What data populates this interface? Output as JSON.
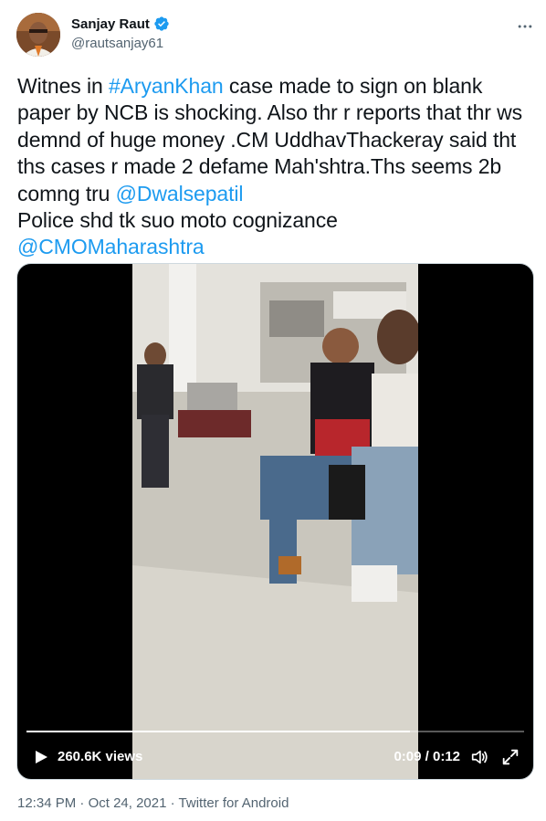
{
  "author": {
    "display_name": "Sanjay Raut",
    "handle": "@rautsanjay61",
    "verified": true
  },
  "tweet": {
    "lines": [
      [
        {
          "text": "Witnes in ",
          "link": false
        },
        {
          "text": "#AryanKhan",
          "link": true
        },
        {
          "text": " case made to sign on blank",
          "link": false
        }
      ],
      [
        {
          "text": "paper by NCB is shocking. Also thr r reports that thr ws",
          "link": false
        }
      ],
      [
        {
          "text": "demnd of huge money .CM UddhavThackeray said tht",
          "link": false
        }
      ],
      [
        {
          "text": "ths cases r made 2 defame Mah'shtra.Ths seems 2b",
          "link": false
        }
      ],
      [
        {
          "text": "comng tru ",
          "link": false
        },
        {
          "text": "@Dwalsepatil",
          "link": true
        }
      ],
      [
        {
          "text": "Police shd tk suo moto cognizance",
          "link": false
        }
      ],
      [
        {
          "text": "@CMOMaharashtra",
          "link": true
        }
      ]
    ]
  },
  "video": {
    "views": "260.6K views",
    "time": "0:09 / 0:12",
    "progress_fraction": 0.77
  },
  "footer": {
    "time": "12:34 PM",
    "separator": "·",
    "date": "Oct 24, 2021",
    "source": "Twitter for Android"
  },
  "colors": {
    "accent": "#1d9bf0",
    "text": "#0f1419",
    "secondary": "#536471"
  },
  "icons": {
    "verified": "verified-badge-icon",
    "more": "more-horizontal-icon",
    "play": "play-icon",
    "volume": "volume-icon",
    "fullscreen": "fullscreen-icon"
  }
}
